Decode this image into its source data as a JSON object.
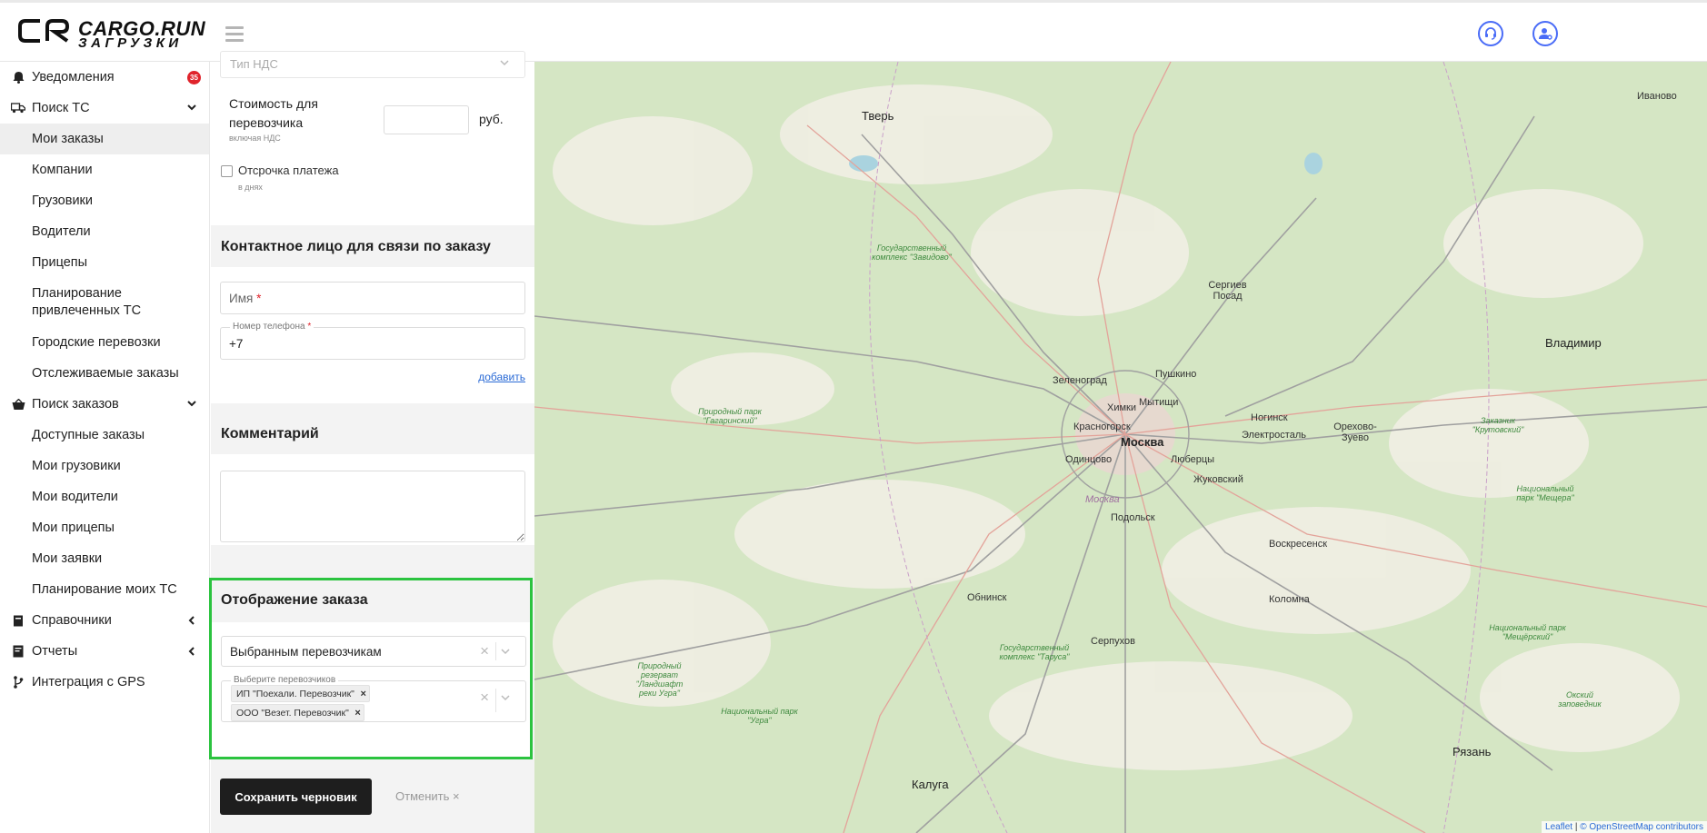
{
  "header": {
    "logo_line1": "CARGO.RUN",
    "logo_line2": "ЗАГРУЗКИ",
    "icons": [
      "support-headset-icon",
      "user-settings-icon"
    ]
  },
  "sidebar": {
    "notifications": {
      "label": "Уведомления",
      "badge": "35"
    },
    "search_ts": {
      "label": "Поиск ТС"
    },
    "search_ts_items": [
      "Мои заказы",
      "Компании",
      "Грузовики",
      "Водители",
      "Прицепы",
      "Планирование привлеченных ТС",
      "Городские перевозки",
      "Отслеживаемые заказы"
    ],
    "search_orders": {
      "label": "Поиск заказов"
    },
    "search_orders_items": [
      "Доступные заказы",
      "Мои грузовики",
      "Мои водители",
      "Мои прицепы",
      "Мои заявки",
      "Планирование моих ТС"
    ],
    "references": {
      "label": "Справочники"
    },
    "reports": {
      "label": "Отчеты"
    },
    "gps": {
      "label": "Интеграция с GPS"
    }
  },
  "form": {
    "vat_placeholder": "Тип НДС",
    "carrier_cost_label": "Стоимость для перевозчика",
    "carrier_cost_hint": "включая НДС",
    "carrier_cost_value": "",
    "currency": "руб.",
    "deferral_label": "Отсрочка платежа",
    "deferral_hint": "в днях",
    "contact_title": "Контактное лицо для связи по заказу",
    "name_placeholder": "Имя",
    "phone_label": "Номер телефона",
    "phone_value": "+7",
    "add_link": "добавить",
    "comment_title": "Комментарий",
    "comment_value": "",
    "display_title": "Отображение заказа",
    "display_value": "Выбранным перевозчикам",
    "carriers_label": "Выберите перевозчиков",
    "carriers": [
      "ИП \"Поехали. Перевозчик\"",
      "ООО \"Везет. Перевозчик\""
    ],
    "save_button": "Сохранить черновик",
    "cancel_button": "Отменить ×"
  },
  "map": {
    "cities": [
      "Тверь",
      "Иваново",
      "Сергиев Посад",
      "Владимир",
      "Зеленоград",
      "Пушкино",
      "Химки",
      "Мытищи",
      "Красногорск",
      "Ногинск",
      "Орехово-Зуево",
      "Москва",
      "Электросталь",
      "Одинцово",
      "Люберцы",
      "Жуковский",
      "Подольск",
      "Воскресенск",
      "Обнинск",
      "Серпухов",
      "Коломна",
      "Калуга",
      "Рязань"
    ],
    "parks": [
      "Государственный комплекс \"Завидово\"",
      "Природный парк \"Гагаринский\"",
      "Заказник \"Крутовский\"",
      "Национальный парк \"Мещера\"",
      "Государственный комплекс \"Таруса\"",
      "Национальный парк \"Мещёрский\"",
      "Природный резерват \"Ландшафт реки Угра\"",
      "Национальный парк \"Угра\"",
      "Окский заповедник"
    ],
    "region_label": "Москва",
    "attribution_leaflet": "Leaflet",
    "attribution_osm": "© OpenStreetMap contributors"
  }
}
